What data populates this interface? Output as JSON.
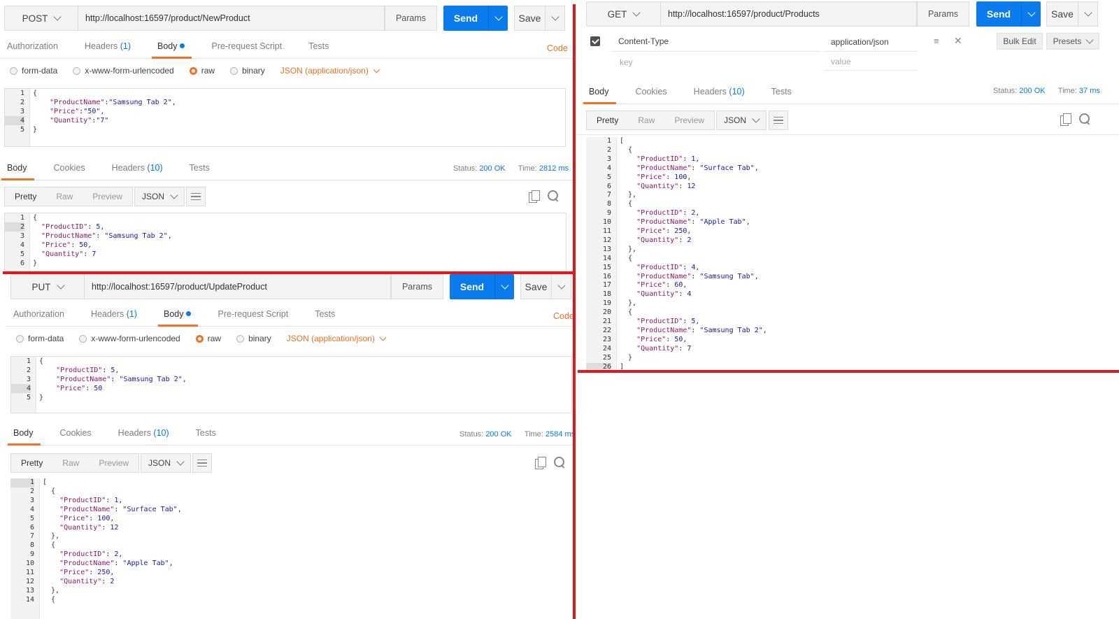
{
  "post": {
    "method": "POST",
    "url": "http://localhost:16597/product/NewProduct",
    "params": "Params",
    "send": "Send",
    "save": "Save",
    "tabs": {
      "authorization": "Authorization",
      "headers": "Headers",
      "headers_count": "(1)",
      "body": "Body",
      "prerequest": "Pre-request Script",
      "tests": "Tests"
    },
    "code": "Code",
    "radios": {
      "form_data": "form-data",
      "urlencoded": "x-www-form-urlencoded",
      "raw": "raw",
      "binary": "binary",
      "content_type": "JSON (application/json)",
      "selected": "raw"
    },
    "request_lines": [
      "1",
      "2",
      "3",
      "4",
      "5"
    ],
    "request_body": [
      "{",
      "    \"ProductName\":\"Samsung Tab 2\",",
      "    \"Price\":\"50\",",
      "    \"Quantity\":\"7\"",
      "}"
    ],
    "response": {
      "tabs": {
        "body": "Body",
        "cookies": "Cookies",
        "headers": "Headers",
        "headers_count": "(10)",
        "tests": "Tests"
      },
      "status_label": "Status:",
      "status": "200 OK",
      "time_label": "Time:",
      "time": "2812 ms",
      "view": {
        "pretty": "Pretty",
        "raw": "Raw",
        "preview": "Preview",
        "format": "JSON"
      },
      "lines": [
        "1",
        "2",
        "3",
        "4",
        "5",
        "6"
      ],
      "body": [
        "{",
        "  \"ProductID\": 5,",
        "  \"ProductName\": \"Samsung Tab 2\",",
        "  \"Price\": 50,",
        "  \"Quantity\": 7",
        "}"
      ]
    }
  },
  "put": {
    "method": "PUT",
    "url": "http://localhost:16597/product/UpdateProduct",
    "params": "Params",
    "send": "Send",
    "save": "Save",
    "tabs": {
      "authorization": "Authorization",
      "headers": "Headers",
      "headers_count": "(1)",
      "body": "Body",
      "prerequest": "Pre-request Script",
      "tests": "Tests"
    },
    "code": "Code",
    "radios": {
      "form_data": "form-data",
      "urlencoded": "x-www-form-urlencoded",
      "raw": "raw",
      "binary": "binary",
      "content_type": "JSON (application/json)",
      "selected": "raw"
    },
    "request_lines": [
      "1",
      "2",
      "3",
      "4",
      "5"
    ],
    "request_body": [
      "{",
      "    \"ProductID\": 5,",
      "    \"ProductName\": \"Samsung Tab 2\",",
      "    \"Price\": 50",
      "}"
    ],
    "response": {
      "tabs": {
        "body": "Body",
        "cookies": "Cookies",
        "headers": "Headers",
        "headers_count": "(10)",
        "tests": "Tests"
      },
      "status_label": "Status:",
      "status": "200 OK",
      "time_label": "Time:",
      "time": "2584 ms",
      "view": {
        "pretty": "Pretty",
        "raw": "Raw",
        "preview": "Preview",
        "format": "JSON"
      },
      "lines": [
        "1",
        "2",
        "3",
        "4",
        "5",
        "6",
        "7",
        "8",
        "9",
        "10",
        "11",
        "12",
        "13",
        "14"
      ],
      "body": [
        "[",
        "  {",
        "    \"ProductID\": 1,",
        "    \"ProductName\": \"Surface Tab\",",
        "    \"Price\": 100,",
        "    \"Quantity\": 12",
        "  },",
        "  {",
        "    \"ProductID\": 2,",
        "    \"ProductName\": \"Apple Tab\",",
        "    \"Price\": 250,",
        "    \"Quantity\": 2",
        "  },",
        "  {"
      ]
    }
  },
  "get": {
    "method": "GET",
    "url": "http://localhost:16597/product/Products",
    "params": "Params",
    "send": "Send",
    "save": "Save",
    "header_row": {
      "key": "Content-Type",
      "value": "application/json",
      "key_placeholder": "key",
      "value_placeholder": "value"
    },
    "bulk_edit": "Bulk Edit",
    "presets": "Presets",
    "response": {
      "tabs": {
        "body": "Body",
        "cookies": "Cookies",
        "headers": "Headers",
        "headers_count": "(10)",
        "tests": "Tests"
      },
      "status_label": "Status:",
      "status": "200 OK",
      "time_label": "Time:",
      "time": "37 ms",
      "view": {
        "pretty": "Pretty",
        "raw": "Raw",
        "preview": "Preview",
        "format": "JSON"
      },
      "lines": [
        "1",
        "2",
        "3",
        "4",
        "5",
        "6",
        "7",
        "8",
        "9",
        "10",
        "11",
        "12",
        "13",
        "14",
        "15",
        "16",
        "17",
        "18",
        "19",
        "20",
        "21",
        "22",
        "23",
        "24",
        "25",
        "26"
      ],
      "body": [
        "[",
        "  {",
        "    \"ProductID\": 1,",
        "    \"ProductName\": \"Surface Tab\",",
        "    \"Price\": 100,",
        "    \"Quantity\": 12",
        "  },",
        "  {",
        "    \"ProductID\": 2,",
        "    \"ProductName\": \"Apple Tab\",",
        "    \"Price\": 250,",
        "    \"Quantity\": 2",
        "  },",
        "  {",
        "    \"ProductID\": 4,",
        "    \"ProductName\": \"Samsung Tab\",",
        "    \"Price\": 60,",
        "    \"Quantity\": 4",
        "  },",
        "  {",
        "    \"ProductID\": 5,",
        "    \"ProductName\": \"Samsung Tab 2\",",
        "    \"Price\": 50,",
        "    \"Quantity\": 7",
        "  }",
        "]"
      ]
    }
  },
  "colors": {
    "accent": "#f47023",
    "send": "#097bed",
    "divider": "#e3161e",
    "status": "#097bed"
  }
}
